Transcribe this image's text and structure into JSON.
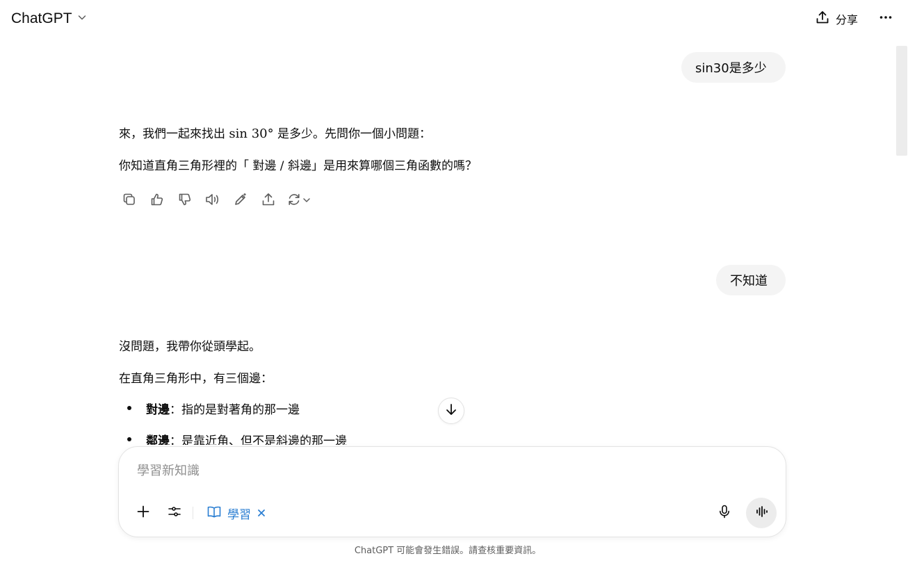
{
  "header": {
    "model_name": "ChatGPT",
    "share_label": "分享"
  },
  "conversation": {
    "user_message_1": "sin30是多少",
    "assistant_1": {
      "line1_pre": "來，我們一起來找出 ",
      "line1_math": "sin 30°",
      "line1_post": " 是多少。先問你一個小問題：",
      "line2": "你知道直角三角形裡的「 對邊 / 斜邊」是用來算哪個三角函數的嗎？"
    },
    "user_message_2": "不知道",
    "assistant_2": {
      "line1": "沒問題，我帶你從頭學起。",
      "line2": "在直角三角形中，有三個邊：",
      "bullets": [
        {
          "term": "對邊",
          "desc": "：指的是對著角的那一邊"
        },
        {
          "term": "鄰邊",
          "desc": "：是靠近角、但不是斜邊的那一邊"
        }
      ]
    }
  },
  "action_icons": [
    "copy-icon",
    "thumbs-up-icon",
    "thumbs-down-icon",
    "read-aloud-icon",
    "edit-pen-icon",
    "share-icon",
    "regenerate-icon"
  ],
  "composer": {
    "placeholder": "學習新知識",
    "study_chip_label": "學習"
  },
  "footer": {
    "disclaimer": "ChatGPT 可能會發生錯誤。請查核重要資訊。"
  },
  "colors": {
    "accent": "#2a7ed2",
    "bubble": "#f4f4f4",
    "text": "#0d0d0d"
  }
}
